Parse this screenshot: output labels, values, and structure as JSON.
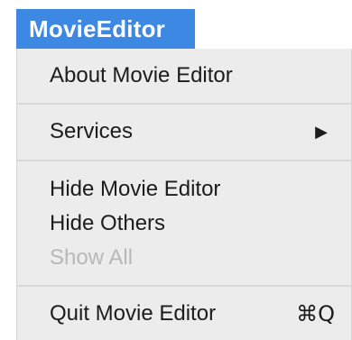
{
  "app_menu": {
    "title": "MovieEditor"
  },
  "menu": {
    "about": "About Movie Editor",
    "services": "Services",
    "services_arrow": "▶",
    "hide": "Hide Movie Editor",
    "hide_others": "Hide Others",
    "show_all": "Show All",
    "quit": "Quit Movie Editor",
    "quit_shortcut": "⌘Q"
  },
  "colors": {
    "highlight": "#3d88e3",
    "menu_background": "#ececec",
    "disabled_text": "#b8b8b8"
  }
}
